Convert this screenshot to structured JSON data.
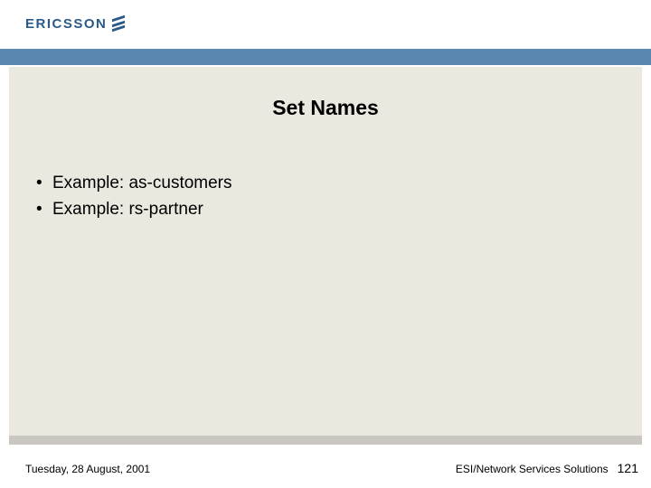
{
  "brand": {
    "name": "ERICSSON"
  },
  "slide": {
    "title": "Set Names",
    "bullets": [
      "Example: as-customers",
      "Example: rs-partner"
    ]
  },
  "footer": {
    "date": "Tuesday, 28 August, 2001",
    "org": "ESI/Network Services Solutions",
    "page": "121"
  }
}
